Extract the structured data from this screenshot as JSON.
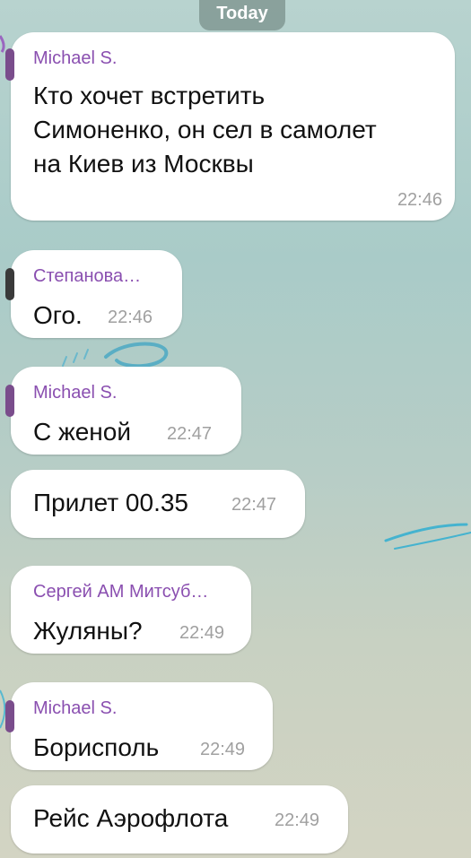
{
  "date_label": "Today",
  "colors": {
    "sender_name": "#8a4fb0",
    "time": "#a0a0a0",
    "bubble": "#ffffff",
    "text": "#111111"
  },
  "messages": [
    {
      "sender": "Michael S.",
      "lines": [
        "Кто хочет встретить",
        "Симоненко, он сел в самолет",
        "на Киев из Москвы"
      ],
      "time": "22:46"
    },
    {
      "sender": "Степанова…",
      "text": "Ого.",
      "time": "22:46"
    },
    {
      "sender": "Michael S.",
      "text": "С женой",
      "time": "22:47"
    },
    {
      "text": "Прилет 00.35",
      "time": "22:47"
    },
    {
      "sender": "Сергей АМ Митсуб…",
      "text": "Жуляны?",
      "time": "22:49"
    },
    {
      "sender": "Michael S.",
      "text": "Борисполь",
      "time": "22:49"
    },
    {
      "text": "Рейс Аэрофлота",
      "time": "22:49"
    }
  ]
}
